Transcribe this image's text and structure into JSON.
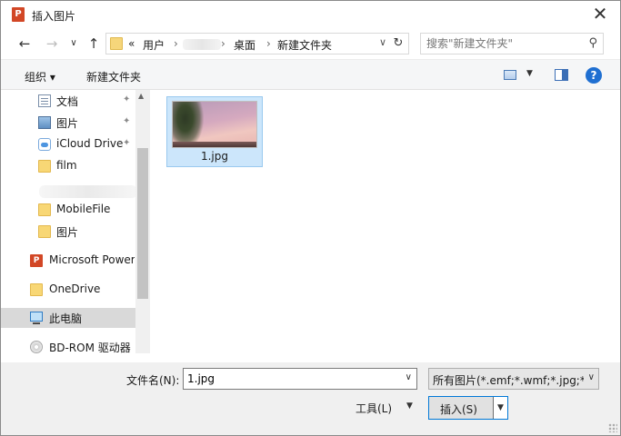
{
  "window": {
    "title": "插入图片",
    "app_icon": "P",
    "close_glyph": "✕"
  },
  "nav": {
    "back_glyph": "←",
    "forward_glyph": "→",
    "recent_glyph": "∨",
    "up_glyph": "↑",
    "breadcrumb": {
      "overflow": "«",
      "items": [
        "用户",
        "桌面",
        "新建文件夹"
      ],
      "separator": "›"
    },
    "refresh_glyph": "↻",
    "search_placeholder": "搜索\"新建文件夹\"",
    "search_glyph": "⚲"
  },
  "toolbar": {
    "organize_label": "组织 ▾",
    "new_folder_label": "新建文件夹",
    "help_glyph": "?"
  },
  "sidebar": {
    "pin_glyph": "✦",
    "items": [
      {
        "label": "文档",
        "icon": "document-icon"
      },
      {
        "label": "图片",
        "icon": "pictures-icon"
      },
      {
        "label": "iCloud Drive",
        "icon": "icloud-icon"
      },
      {
        "label": "film",
        "icon": "folder-icon"
      },
      {
        "label": "MobileFile",
        "icon": "folder-icon"
      },
      {
        "label": "图片",
        "icon": "folder-icon"
      },
      {
        "label": "Microsoft Power",
        "icon": "powerpoint-icon"
      },
      {
        "label": "OneDrive",
        "icon": "folder-icon"
      },
      {
        "label": "此电脑",
        "icon": "computer-icon"
      },
      {
        "label": "BD-ROM 驱动器",
        "icon": "disc-icon"
      }
    ]
  },
  "content": {
    "files": [
      {
        "name": "1.jpg",
        "selected": true
      }
    ]
  },
  "footer": {
    "filename_label": "文件名(N):",
    "filename_value": "1.jpg",
    "filetype_value": "所有图片(*.emf;*.wmf;*.jpg;*.jp",
    "tools_label": "工具(L)",
    "insert_label": "插入(S)",
    "dropdown_glyph": "∨"
  },
  "colors": {
    "selection_bg": "#cce6fb",
    "accent": "#0078d7",
    "powerpoint": "#d24726"
  }
}
